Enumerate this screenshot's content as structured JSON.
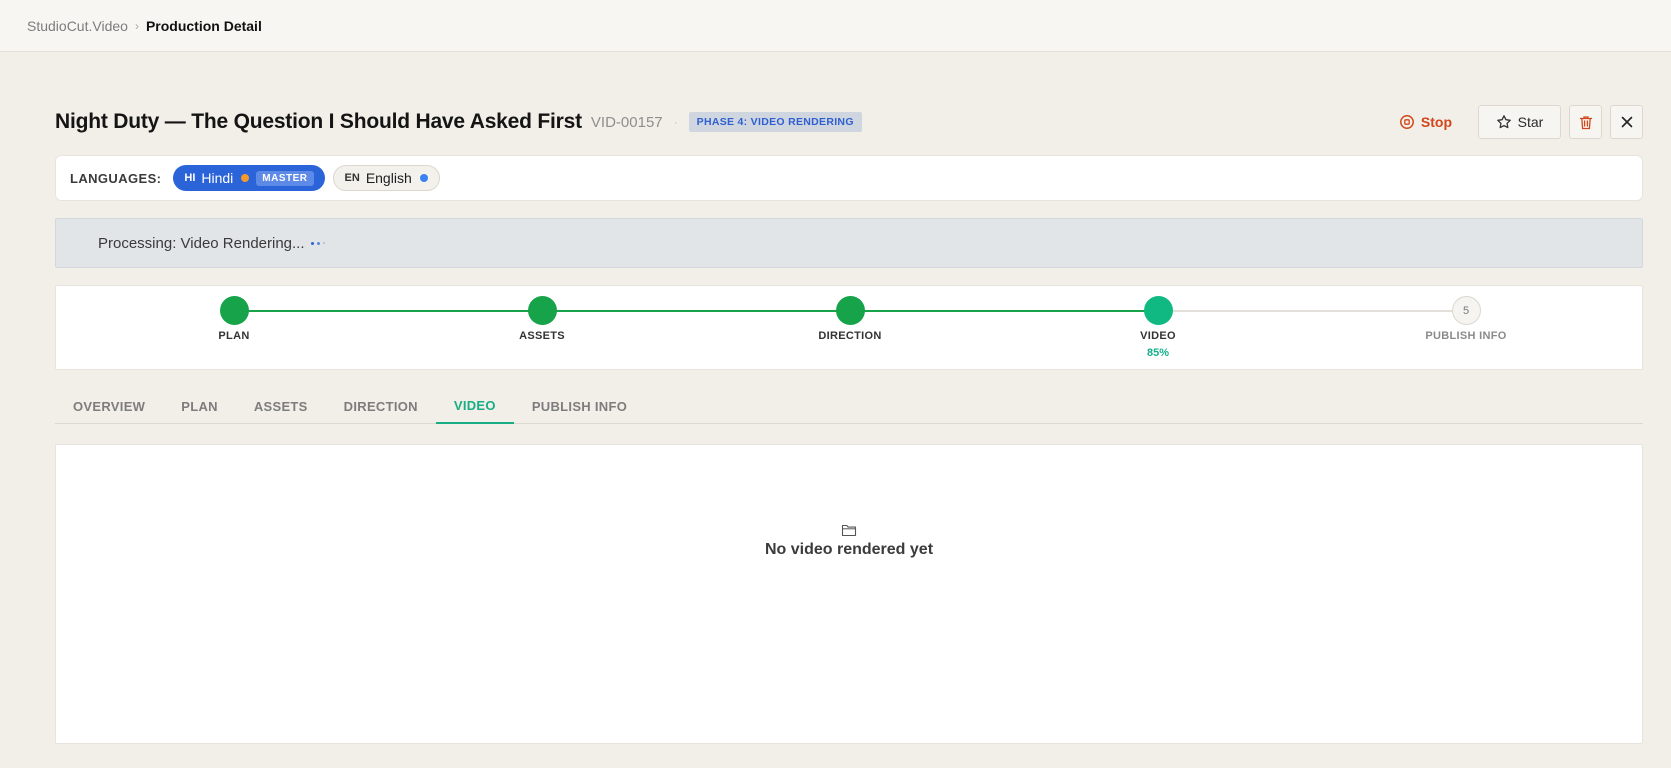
{
  "breadcrumb": {
    "root": "StudioCut.Video",
    "separator": "›",
    "current": "Production Detail"
  },
  "header": {
    "title": "Night Duty — The Question I Should Have Asked First",
    "video_id": "VID-00157",
    "separator": "·",
    "phase_badge": "PHASE 4: VIDEO RENDERING",
    "actions": {
      "stop_label": "Stop",
      "star_label": "Star",
      "delete_icon": "trash-icon",
      "close_icon": "close-icon"
    }
  },
  "languages": {
    "label": "LANGUAGES:",
    "items": [
      {
        "code": "HI",
        "name": "Hindi",
        "badge": "MASTER",
        "dot_color": "#f39a2b",
        "active": true
      },
      {
        "code": "EN",
        "name": "English",
        "dot_color": "#3b82f6",
        "active": false
      }
    ]
  },
  "processing": {
    "text": "Processing: Video Rendering..."
  },
  "stepper": {
    "steps": [
      {
        "label": "PLAN",
        "status": "complete"
      },
      {
        "label": "ASSETS",
        "status": "complete"
      },
      {
        "label": "DIRECTION",
        "status": "complete"
      },
      {
        "label": "VIDEO",
        "status": "active",
        "progress_text": "85%"
      },
      {
        "label": "PUBLISH INFO",
        "status": "pending",
        "number": "5"
      }
    ]
  },
  "tabs": {
    "items": [
      "OVERVIEW",
      "PLAN",
      "ASSETS",
      "DIRECTION",
      "VIDEO",
      "PUBLISH INFO"
    ],
    "active": "VIDEO"
  },
  "content": {
    "empty_icon": "folder-icon",
    "empty_text": "No video rendered yet"
  },
  "colors": {
    "accent_blue": "#2b63d9",
    "complete_green": "#16a34a",
    "active_teal": "#10b981",
    "stop_red": "#d0461a"
  }
}
